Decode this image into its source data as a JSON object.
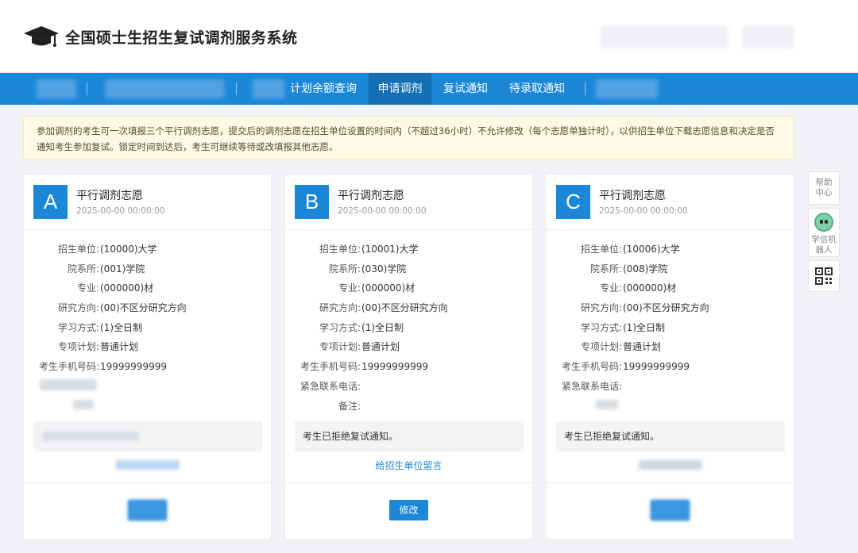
{
  "header": {
    "title": "全国硕士生招生复试调剂服务系统"
  },
  "nav": {
    "items": [
      {
        "label": "计划余额查询",
        "active": false
      },
      {
        "label": "申请调剂",
        "active": true
      },
      {
        "label": "复试通知",
        "active": false
      },
      {
        "label": "待录取通知",
        "active": false
      }
    ]
  },
  "notice": {
    "text": "参加调剂的考生可一次填报三个平行调剂志愿，提交后的调剂志愿在招生单位设置的时间内（不超过36小时）不允许修改（每个志愿单独计时），以供招生单位下载志愿信息和决定是否通知考生参加复试。锁定时间到达后，考生可继续等待或改填报其他志愿。"
  },
  "cards": [
    {
      "letter": "A",
      "title": "平行调剂志愿",
      "time": "2025-00-00 00:00:00",
      "fields": [
        {
          "label": "招生单位:",
          "value": "(10000)大学"
        },
        {
          "label": "院系所:",
          "value": "(001)学院"
        },
        {
          "label": "专业:",
          "value": "(000000)材"
        },
        {
          "label": "研究方向:",
          "value": "(00)不区分研究方向"
        },
        {
          "label": "学习方式:",
          "value": "(1)全日制"
        },
        {
          "label": "专项计划:",
          "value": "普通计划"
        },
        {
          "label": "考生手机号码:",
          "value": "19999999999"
        }
      ]
    },
    {
      "letter": "B",
      "title": "平行调剂志愿",
      "time": "2025-00-00 00:00:00",
      "fields": [
        {
          "label": "招生单位:",
          "value": "(10001)大学"
        },
        {
          "label": "院系所:",
          "value": "(030)学院"
        },
        {
          "label": "专业:",
          "value": "(000000)材"
        },
        {
          "label": "研究方向:",
          "value": "(00)不区分研究方向"
        },
        {
          "label": "学习方式:",
          "value": "(1)全日制"
        },
        {
          "label": "专项计划:",
          "value": "普通计划"
        },
        {
          "label": "考生手机号码:",
          "value": "19999999999"
        },
        {
          "label": "紧急联系电话:",
          "value": ""
        },
        {
          "label": "备注:",
          "value": ""
        }
      ],
      "status": "考生已拒绝复试通知。",
      "link": "给招生单位留言",
      "button": "修改"
    },
    {
      "letter": "C",
      "title": "平行调剂志愿",
      "time": "2025-00-00 00:00:00",
      "fields": [
        {
          "label": "招生单位:",
          "value": "(10006)大学"
        },
        {
          "label": "院系所:",
          "value": "(008)学院"
        },
        {
          "label": "专业:",
          "value": "(000000)材"
        },
        {
          "label": "研究方向:",
          "value": "(00)不区分研究方向"
        },
        {
          "label": "学习方式:",
          "value": "(1)全日制"
        },
        {
          "label": "专项计划:",
          "value": "普通计划"
        },
        {
          "label": "考生手机号码:",
          "value": "19999999999"
        },
        {
          "label": "紧急联系电话:",
          "value": ""
        }
      ],
      "status": "考生已拒绝复试通知。"
    }
  ],
  "side": {
    "help": "帮助中心",
    "robot": "学信机器人"
  },
  "colors": {
    "primary": "#1a87d9",
    "nav_active": "#156fb4",
    "notice_bg": "#fdf9e5"
  }
}
